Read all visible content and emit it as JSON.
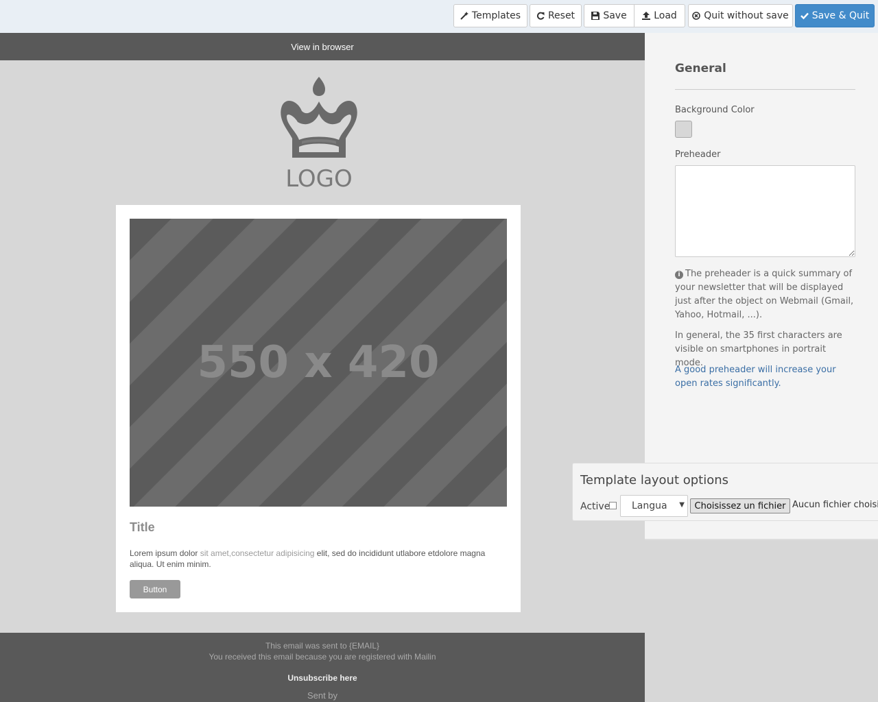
{
  "toolbar": {
    "templates_label": "Templates",
    "reset_label": "Reset",
    "save_label": "Save",
    "load_label": "Load",
    "quit_label": "Quit without save",
    "save_quit_label": "Save & Quit",
    "icons": [
      "magic-wand-icon",
      "refresh-icon",
      "floppy-disk-icon",
      "upload-icon",
      "close-circle-icon",
      "check-icon"
    ],
    "primary_color": "#428bca"
  },
  "canvas": {
    "view_in_browser": "View in browser",
    "logo_text": "LOGO",
    "placeholder_text": "550 x 420",
    "title": "Title",
    "body_before": "Lorem ipsum dolor ",
    "body_highlight": "sit amet,consectetur adipisicing",
    "body_after": " elit, sed do incididunt utlabore etdolore magna aliqua. Ut enim minim.",
    "button_label": "Button",
    "background_color": "#d7d7d7"
  },
  "footer": {
    "line1": "This email was sent to {EMAIL}",
    "line2": "You received this email because you are registered with Mailin",
    "unsubscribe": "Unsubscribe here",
    "sent_by": "Sent by"
  },
  "panel": {
    "title": "General",
    "background_color_label": "Background Color",
    "preheader_label": "Preheader",
    "preheader_value": "",
    "info_text": "The preheader is a quick summary of your newsletter that will be displayed just after the object on Webmail (Gmail, Yahoo, Hotmail, ...).",
    "general_text": "In general, the 35 first characters are visible on smartphones in portrait mode.",
    "link_text": "A good preheader will increase your open rates significantly."
  },
  "layout_options": {
    "title": "Template layout options",
    "active_label": "Active",
    "active_checked": false,
    "language_value": "Langua",
    "file_button": "Choisissez un fichier",
    "no_file": "Aucun fichier choisi"
  }
}
